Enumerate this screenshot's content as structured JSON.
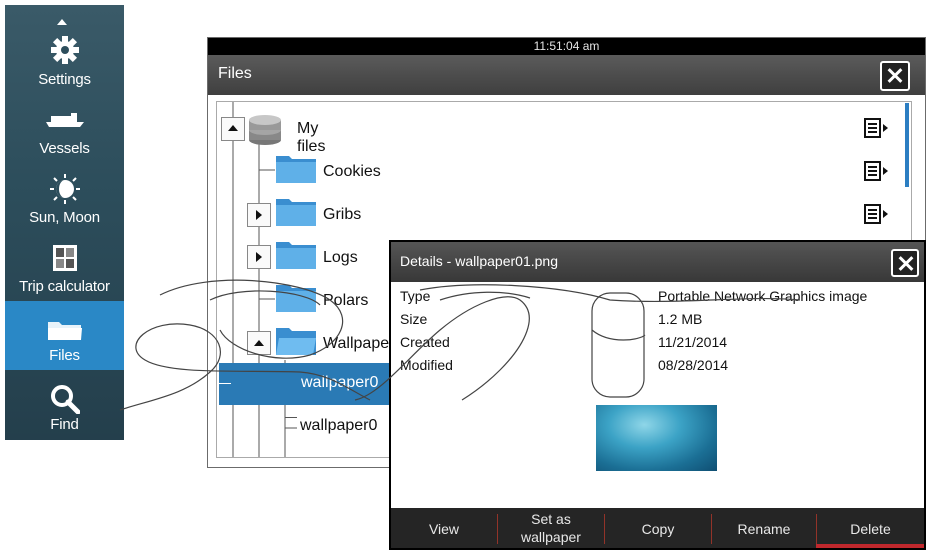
{
  "sidebar": {
    "items": [
      {
        "label": "Settings",
        "icon": "gear-icon"
      },
      {
        "label": "Vessels",
        "icon": "ship-icon"
      },
      {
        "label": "Sun, Moon",
        "icon": "moon-icon"
      },
      {
        "label": "Trip calculator",
        "icon": "calculator-icon"
      },
      {
        "label": "Files",
        "icon": "folder-icon",
        "active": true
      },
      {
        "label": "Find",
        "icon": "search-icon"
      }
    ]
  },
  "files_window": {
    "clock": "11:51:04 am",
    "title": "Files",
    "tree": {
      "root": "My files",
      "items": [
        "Cookies",
        "Gribs",
        "Logs",
        "Polars",
        "Wallpape",
        "wallpaper0",
        "wallpaper0"
      ]
    }
  },
  "details": {
    "title": "Details - wallpaper01.png",
    "fields": [
      {
        "label": "Type",
        "value": "Portable Network Graphics image"
      },
      {
        "label": "Size",
        "value": "1.2 MB"
      },
      {
        "label": "Created",
        "value": "11/21/2014"
      },
      {
        "label": "Modified",
        "value": "08/28/2014"
      }
    ],
    "buttons": {
      "view": "View",
      "set_wallpaper_1": "Set as",
      "set_wallpaper_2": "wallpaper",
      "copy": "Copy",
      "rename": "Rename",
      "delete": "Delete"
    }
  },
  "colors": {
    "accent": "#2a88c6",
    "delete": "#c0282d",
    "titlebar": "#444444"
  }
}
